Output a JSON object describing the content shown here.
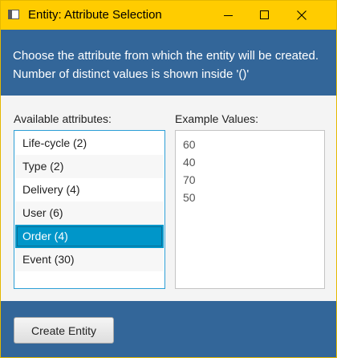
{
  "window": {
    "title": "Entity: Attribute Selection"
  },
  "header": {
    "line1": "Choose the attribute from which the entity will be created.",
    "line2": "Number of distinct values is shown inside '()'"
  },
  "attributes": {
    "label": "Available attributes:",
    "selected_index": 4,
    "items": [
      {
        "label": "Life-cycle (2)"
      },
      {
        "label": "Type (2)"
      },
      {
        "label": "Delivery (4)"
      },
      {
        "label": "User (6)"
      },
      {
        "label": "Order (4)"
      },
      {
        "label": "Event (30)"
      }
    ]
  },
  "examples": {
    "label": "Example Values:",
    "values": [
      "60",
      "40",
      "70",
      "50"
    ]
  },
  "footer": {
    "create_label": "Create Entity"
  },
  "colors": {
    "titlebar": "#ffcc00",
    "header": "#336699",
    "selection": "#0096c9",
    "focus_border": "#2c9fd6"
  },
  "icons": {
    "app": "window-icon",
    "minimize": "minimize-icon",
    "maximize": "maximize-icon",
    "close": "close-icon"
  }
}
